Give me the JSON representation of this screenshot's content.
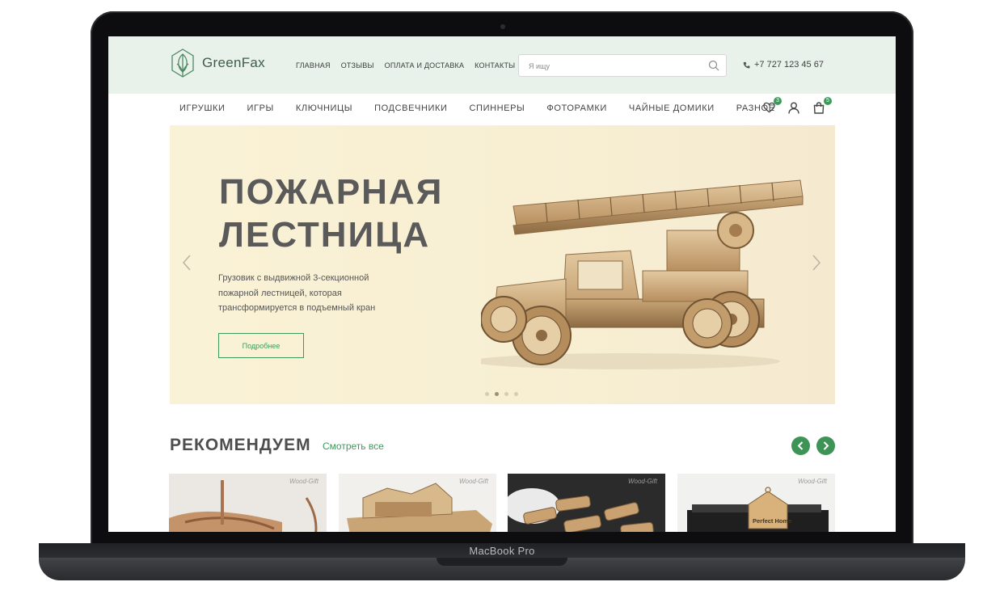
{
  "device": {
    "label": "MacBook Pro"
  },
  "header": {
    "brand": "GreenFax",
    "nav": [
      "ГЛАВНАЯ",
      "ОТЗЫВЫ",
      "ОПЛАТА И ДОСТАВКА",
      "КОНТАКТЫ"
    ],
    "search": {
      "placeholder": "Я ищу",
      "value": ""
    },
    "phone": "+7 727 123 45 67"
  },
  "categories": [
    "ИГРУШКИ",
    "ИГРЫ",
    "КЛЮЧНИЦЫ",
    "ПОДСВЕЧНИКИ",
    "СПИННЕРЫ",
    "ФОТОРАМКИ",
    "ЧАЙНЫЕ ДОМИКИ",
    "РАЗНОЕ"
  ],
  "user_icons": {
    "favorites_count": "3",
    "cart_count": "5"
  },
  "hero": {
    "title_line1": "ПОЖАРНАЯ",
    "title_line2": "ЛЕСТНИЦА",
    "desc_line1": "Грузовик с выдвижной 3-секционной",
    "desc_line2": "пожарной лестницей, которая",
    "desc_line3": "трансформируется в подъемный кран",
    "button": "Подробнее",
    "slides": 4,
    "active_slide": 2
  },
  "recommended": {
    "title": "РЕКОМЕНДУЕМ",
    "link": "Смотреть все",
    "cards": [
      {
        "watermark": "Wood-Gift"
      },
      {
        "watermark": "Wood-Gift"
      },
      {
        "watermark": "Wood-Gift"
      },
      {
        "watermark": "Wood-Gift",
        "tag_text": "Perfect Home"
      }
    ]
  },
  "colors": {
    "accent": "#3d9a5b",
    "topbar": "#e8f1ea",
    "hero_bg": "#f8efd3"
  }
}
